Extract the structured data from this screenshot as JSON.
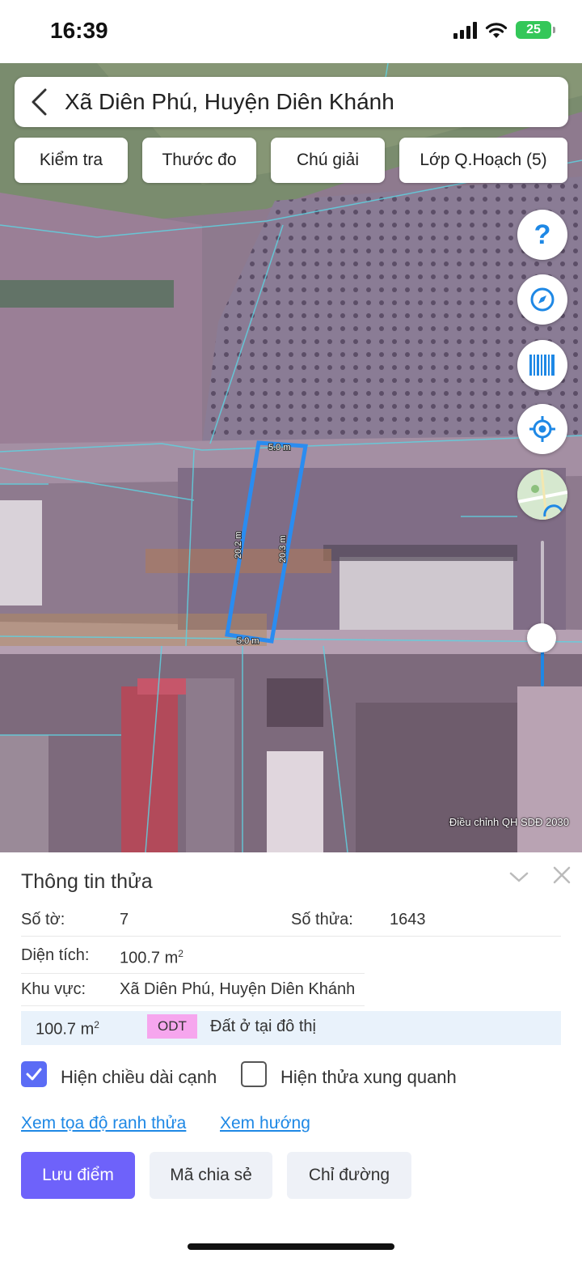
{
  "status_bar": {
    "time": "16:39",
    "battery": "25"
  },
  "search": {
    "location": "Xã Diên Phú, Huyện Diên Khánh"
  },
  "toolbar": {
    "buttons": [
      "Kiểm tra",
      "Thước đo",
      "Chú giải",
      "Lớp Q.Hoạch (5)"
    ]
  },
  "map_controls": {
    "help": "?",
    "icons": [
      "help-icon",
      "compass-icon",
      "barcode-icon",
      "locate-icon",
      "map-layer-icon"
    ],
    "zoom_level": 0.33
  },
  "parcel_dimensions": {
    "top": "5.0 m",
    "bottom": "5.0 m",
    "left": "20.2 m",
    "right": "20.3 m"
  },
  "map_caption": "Điều chỉnh QH SDĐ 2030",
  "panel": {
    "title": "Thông tin thửa",
    "so_to_label": "Số tờ:",
    "so_to_value": "7",
    "so_thua_label": "Số thửa:",
    "so_thua_value": "1643",
    "dien_tich_label": "Diện tích:",
    "dien_tich_value": "100.7 m",
    "dien_tich_unit_sup": "2",
    "khu_vuc_label": "Khu vực:",
    "khu_vuc_value": "Xã Diên Phú, Huyện Diên Khánh",
    "land_use": {
      "area": "100.7 m",
      "area_sup": "2",
      "code": "ODT",
      "code_color": "#f6a6ee",
      "description": "Đất ở tại đô thị"
    },
    "checkboxes": [
      {
        "label": "Hiện chiều dài cạnh",
        "checked": true
      },
      {
        "label": "Hiện thửa xung quanh",
        "checked": false
      }
    ],
    "links": [
      "Xem tọa độ ranh thửa",
      "Xem hướng"
    ],
    "actions": [
      "Lưu điểm",
      "Mã chia sẻ",
      "Chỉ đường"
    ]
  },
  "colors": {
    "accent": "#6e62fa",
    "link": "#1e88e5",
    "parcel_outline": "#2a8cf0"
  }
}
